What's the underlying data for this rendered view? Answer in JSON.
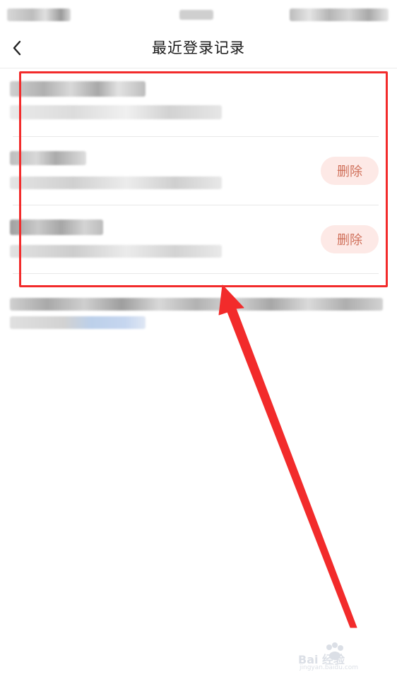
{
  "nav": {
    "title": "最近登录记录"
  },
  "records": [
    {
      "has_delete": false
    },
    {
      "has_delete": true,
      "delete_label": "删除"
    },
    {
      "has_delete": true,
      "delete_label": "删除"
    }
  ],
  "watermark": {
    "brand": "Bai 经验",
    "domain": "jingyan.baidu.com"
  },
  "colors": {
    "annotation": "#f22b2b",
    "delete_bg": "#fde9e6",
    "delete_text": "#d0705a",
    "divider": "#e8e8e8"
  },
  "icons": {
    "back": "chevron-left-icon"
  }
}
